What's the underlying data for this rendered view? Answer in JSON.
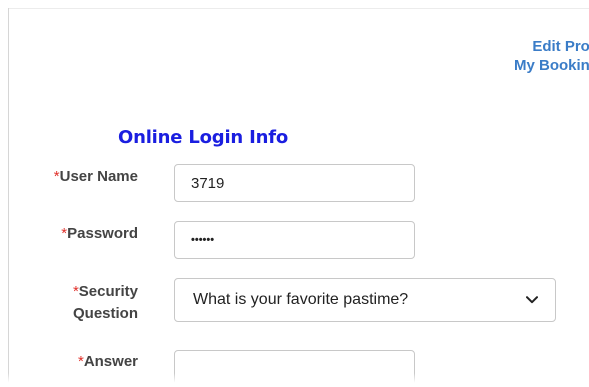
{
  "nav": {
    "edit_profile": "Edit Profi",
    "my_bookings": "My Booking"
  },
  "section": {
    "title": "Online Login Info"
  },
  "form": {
    "required_mark": "*",
    "username": {
      "label": "User Name",
      "value": "3719"
    },
    "password": {
      "label": "Password",
      "masked_value": "••••••"
    },
    "security_question": {
      "label_line1": "Security",
      "label_line2": "Question",
      "selected": "What is your favorite pastime?"
    },
    "answer": {
      "label": "Answer",
      "value": ""
    }
  },
  "colors": {
    "link": "#3a7cc7",
    "section_title": "#1a1ee0",
    "required": "#e0302a",
    "label": "#444444"
  }
}
